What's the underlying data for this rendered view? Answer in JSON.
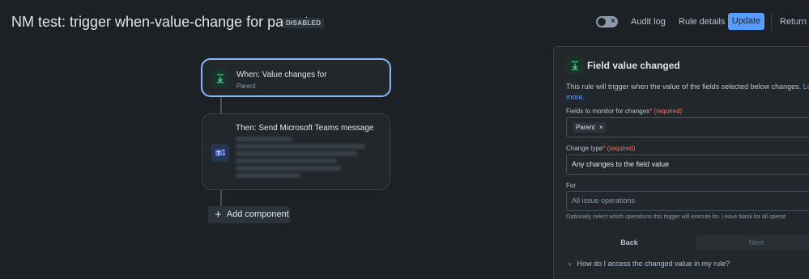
{
  "header": {
    "title": "NM test: trigger when-value-change for parent",
    "badge": "DISABLED",
    "toggle_state": "off",
    "audit_log": "Audit log",
    "rule_details": "Rule details",
    "update": "Update",
    "return": "Return to"
  },
  "flow": {
    "trigger": {
      "title": "When: Value changes for",
      "subtitle": "Parent",
      "icon": "field-value-changed-icon"
    },
    "action": {
      "title": "Then: Send Microsoft Teams message",
      "icon": "microsoft-teams-icon"
    },
    "add_component": "Add component"
  },
  "panel": {
    "title": "Field value changed",
    "description": "This rule will trigger when the value of the fields selected below changes.",
    "link_part1": "Le",
    "link_part2": "more.",
    "fields_label": "Fields to monitor for changes",
    "required_star": "*",
    "required_text": "(required)",
    "selected_field_tag": "Parent",
    "change_type_label": "Change type",
    "change_type_value": "Any changes to the field value",
    "for_label": "For",
    "for_placeholder": "All issue operations",
    "help_text": "Optionally select which operations this trigger will execute for. Leave blank for all operat",
    "back": "Back",
    "next": "Next",
    "faq": "How do I access the changed value in my rule?"
  },
  "colors": {
    "background": "#1d2125",
    "accent": "#579dff",
    "selected_border": "#85b8ff",
    "required": "#f87168"
  }
}
